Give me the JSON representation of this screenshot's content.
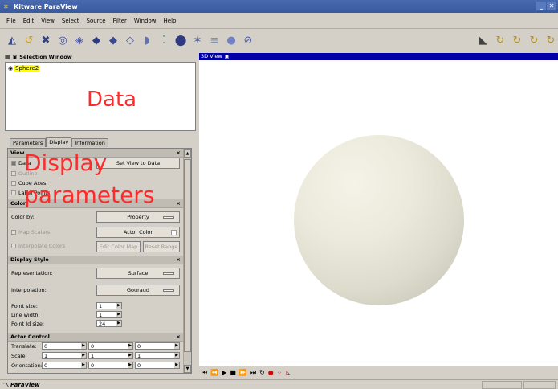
{
  "window": {
    "title": "Kitware ParaView"
  },
  "menu": [
    "File",
    "Edit",
    "View",
    "Select",
    "Source",
    "Filter",
    "Window",
    "Help"
  ],
  "toolbar": {
    "left_icons": [
      "calculator-icon",
      "contour-icon",
      "cut-icon",
      "clip-icon",
      "threshold-icon",
      "extract-grid-icon",
      "glyph-icon",
      "stream-tracer-icon",
      "warp-icon",
      "group-icon",
      "probe-icon",
      "axes-icon",
      "tube-icon",
      "sphere-icon",
      "disk-icon"
    ],
    "right_icons": [
      "camera-icon",
      "reset-camera-icon",
      "rotate-x-icon",
      "rotate-y-icon",
      "rotate-z-icon"
    ]
  },
  "selection_window": {
    "title": "Selection Window",
    "item": "Sphere2"
  },
  "overlays": {
    "data": "Data",
    "display_line1": "Display",
    "display_line2": "parameters"
  },
  "tabs": [
    "Parameters",
    "Display",
    "Information"
  ],
  "view_section": {
    "header": "View",
    "data_label": "Data",
    "set_view_button": "Set View to Data",
    "outline_label": "Outline",
    "cube_axes_label": "Cube Axes",
    "label_points_label": "Label Points"
  },
  "color_section": {
    "header": "Color",
    "color_by_label": "Color by:",
    "color_by_value": "Property",
    "map_scalars_label": "Map Scalars",
    "actor_color_button": "Actor Color",
    "interpolate_colors_label": "Interpolate Colors",
    "edit_color_map_button": "Edit Color Map",
    "reset_range_button": "Reset Range"
  },
  "display_style": {
    "header": "Display Style",
    "representation_label": "Representation:",
    "representation_value": "Surface",
    "interpolation_label": "Interpolation:",
    "interpolation_value": "Gouraud",
    "point_size_label": "Point size:",
    "point_size_value": "1",
    "line_width_label": "Line width:",
    "line_width_value": "1",
    "point_id_size_label": "Point Id size:",
    "point_id_size_value": "24"
  },
  "actor_control": {
    "header": "Actor Control",
    "translate_label": "Translate:",
    "translate": [
      "0",
      "0",
      "0"
    ],
    "scale_label": "Scale:",
    "scale": [
      "1",
      "1",
      "1"
    ],
    "orientation_label": "Orientation:",
    "orientation": [
      "0",
      "0",
      "0"
    ]
  },
  "view": {
    "title": "3D View"
  },
  "status": {
    "text": "ParaView"
  },
  "colors": {
    "overlay_red": "#ff2a2a",
    "view_title_bg": "#0000a8",
    "highlight": "#ffff00"
  }
}
